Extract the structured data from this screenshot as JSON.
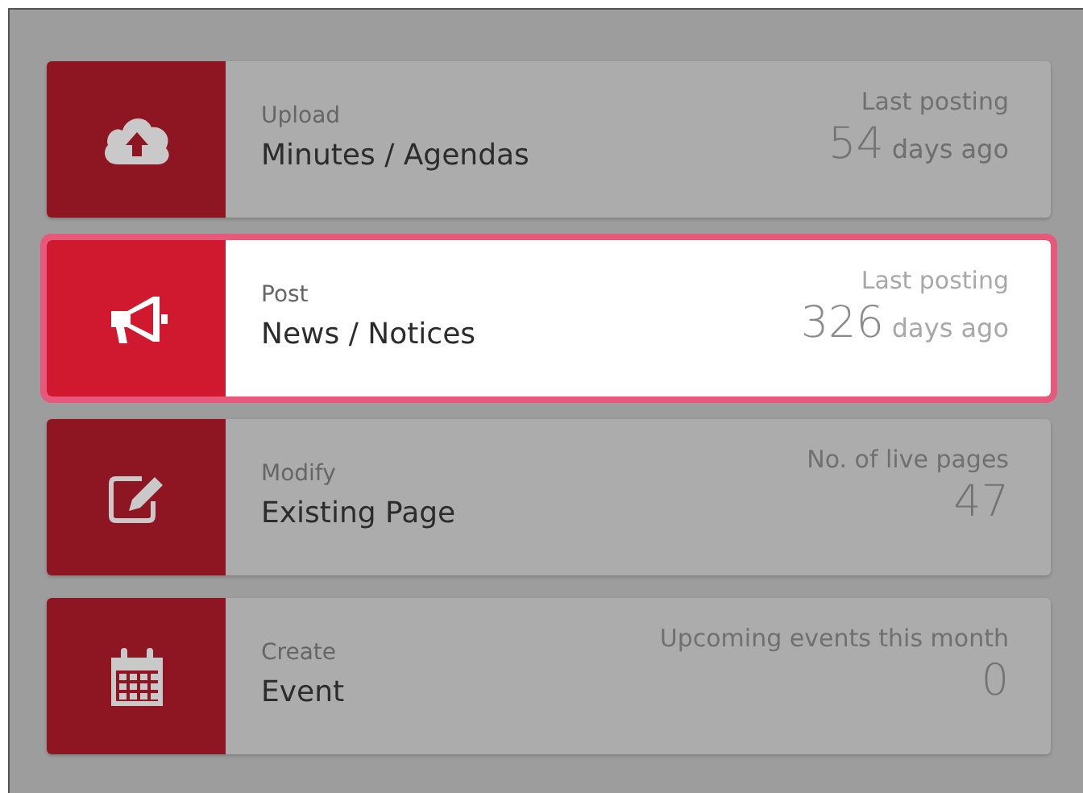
{
  "tiles": [
    {
      "kind": "cloud-upload",
      "selected": false,
      "action": "Upload",
      "title": "Minutes / Agendas",
      "stat_label": "Last posting",
      "stat_value": "54",
      "stat_unit": "days ago"
    },
    {
      "kind": "megaphone",
      "selected": true,
      "action": "Post",
      "title": "News / Notices",
      "stat_label": "Last posting",
      "stat_value": "326",
      "stat_unit": "days ago"
    },
    {
      "kind": "edit",
      "selected": false,
      "action": "Modify",
      "title": "Existing Page",
      "stat_label": "No. of live pages",
      "stat_value": "47"
    },
    {
      "kind": "calendar",
      "selected": false,
      "action": "Create",
      "title": "Event",
      "stat_label": "Upcoming events this month",
      "stat_value": "0"
    }
  ]
}
